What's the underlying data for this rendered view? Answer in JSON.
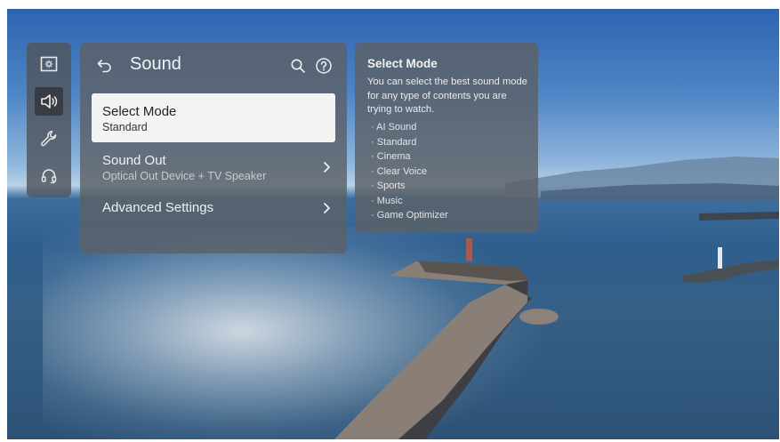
{
  "sidebar": {
    "items": [
      {
        "icon": "picture-settings-icon",
        "active": false
      },
      {
        "icon": "speaker-icon",
        "active": true
      },
      {
        "icon": "wrench-icon",
        "active": false
      },
      {
        "icon": "headset-support-icon",
        "active": false
      }
    ]
  },
  "panel": {
    "title": "Sound",
    "items": [
      {
        "label": "Select Mode",
        "sub": "Standard",
        "focused": true
      },
      {
        "label": "Sound Out",
        "sub": "Optical Out Device + TV Speaker",
        "has_arrow": true
      },
      {
        "label": "Advanced Settings",
        "has_arrow": true
      }
    ]
  },
  "info": {
    "title": "Select Mode",
    "description": "You can select the best sound mode for any type of contents you are trying to watch.",
    "options": [
      "AI Sound",
      "Standard",
      "Cinema",
      "Clear Voice",
      "Sports",
      "Music",
      "Game Optimizer"
    ]
  },
  "colors": {
    "panel_bg": "#5c6066",
    "focus_bg": "#f3f3f3",
    "sky": "#2c64b0",
    "sea": "#2f5f8e"
  }
}
